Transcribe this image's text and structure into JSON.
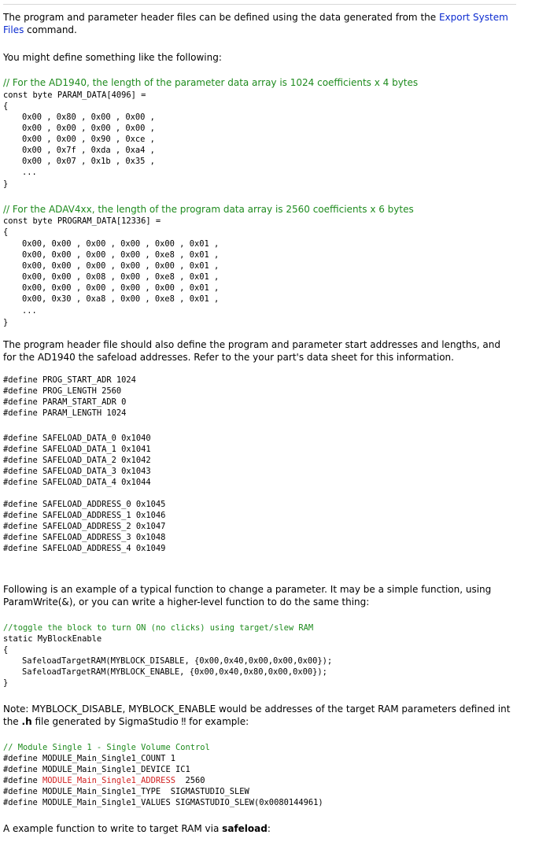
{
  "intro": {
    "text_before": "The program and parameter header files can be defined using the data generated from the ",
    "link": "Export System Files",
    "text_after": " command."
  },
  "lead": "You might define something like the following:",
  "param_block": {
    "comment": "// For the AD1940,  the length of the parameter data array is 1024 coefficients x 4 bytes",
    "decl": "const byte PARAM_DATA[4096] =",
    "open": "{",
    "rows": [
      "0x00 , 0x80 , 0x00 , 0x00 ,",
      "0x00 , 0x00 , 0x00 , 0x00 ,",
      "0x00 , 0x00 , 0x90 , 0xce ,",
      "0x00 , 0x7f , 0xda , 0xa4 ,",
      "0x00 , 0x07 , 0x1b , 0x35 ,"
    ],
    "ellipsis": "...",
    "close": "}"
  },
  "prog_block": {
    "comment": "// For the ADAV4xx,  the length of the program data array is 2560 coefficients x 6 bytes",
    "decl": "const byte PROGRAM_DATA[12336] =",
    "open": "{",
    "rows": [
      "0x00, 0x00 , 0x00 , 0x00 , 0x00 , 0x01 ,",
      "0x00, 0x00 , 0x00 , 0x00 , 0xe8 , 0x01 ,",
      "0x00, 0x00 , 0x00 , 0x00 , 0x00 , 0x01 ,",
      "0x00, 0x00 , 0x08 , 0x00 , 0xe8 , 0x01 ,",
      "0x00, 0x00 , 0x00 , 0x00 , 0x00 , 0x01 ,",
      "0x00, 0x30 , 0xa8 , 0x00 , 0xe8 , 0x01 ,"
    ],
    "ellipsis": "...",
    "close": "}"
  },
  "header_text": "The program header file should also define the  program and parameter start addresses and lengths, and for the AD1940 the safeload addresses.  Refer to the your part's data sheet for this information.",
  "defines_prog": [
    "#define PROG_START_ADR 1024",
    "#define PROG_LENGTH 2560",
    "#define PARAM_START_ADR 0",
    "#define PARAM_LENGTH 1024"
  ],
  "defines_safeload_data": [
    "#define SAFELOAD_DATA_0 0x1040",
    "#define SAFELOAD_DATA_1 0x1041",
    "#define SAFELOAD_DATA_2 0x1042",
    "#define SAFELOAD_DATA_3 0x1043",
    "#define SAFELOAD_DATA_4 0x1044"
  ],
  "defines_safeload_addr": [
    "#define SAFELOAD_ADDRESS_0 0x1045",
    "#define SAFELOAD_ADDRESS_1 0x1046",
    "#define SAFELOAD_ADDRESS_2 0x1047",
    "#define SAFELOAD_ADDRESS_3 0x1048",
    "#define SAFELOAD_ADDRESS_4 0x1049"
  ],
  "following_text": "Following is an example of a typical function to change a parameter. It may be a simple function, using ParamWrite(&), or you can write a higher-level function to do the same thing:",
  "toggle_block": {
    "comment": "//toggle the block to turn ON (no clicks) using target/slew RAM",
    "decl": "static MyBlockEnable",
    "open": "{",
    "line1": "SafeloadTargetRAM(MYBLOCK_DISABLE, {0x00,0x40,0x00,0x00,0x00});",
    "line2": "SafeloadTargetRAM(MYBLOCK_ENABLE, {0x00,0x40,0x80,0x00,0x00});",
    "close": "}"
  },
  "note": {
    "text": "Note: MYBLOCK_DISABLE, MYBLOCK_ENABLE would be addresses of the target RAM parameters defined int the ",
    "bold": ".h",
    "text2": " file generated by SigmaStudio ‼  for example:"
  },
  "module_block": {
    "comment": "// Module Single 1 - Single Volume Control",
    "l1": "#define MODULE_Main_Single1_COUNT 1",
    "l2": "#define MODULE_Main_Single1_DEVICE IC1",
    "l3_prefix": "#define ",
    "l3_red": "MODULE_Main_Single1_ADDRESS",
    "l3_suffix": "  2560",
    "l4": "#define MODULE_Main_Single1_TYPE  SIGMASTUDIO_SLEW",
    "l5": "#define MODULE_Main_Single1_VALUES SIGMASTUDIO_SLEW(0x0080144961)"
  },
  "final": {
    "text": "A example function to write to target RAM via ",
    "bold": "safeload",
    "colon": ":"
  }
}
